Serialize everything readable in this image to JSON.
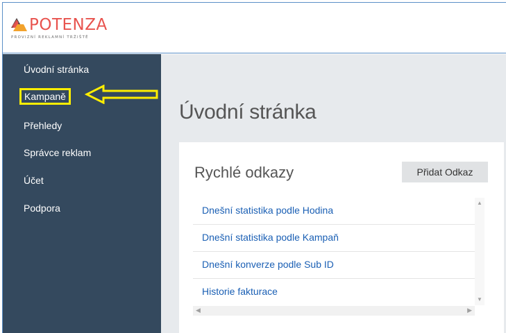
{
  "brand": {
    "name": "POTENZA",
    "tagline": "PROVIZNÍ REKLAMNÍ TRŽIŠTĚ",
    "colors": {
      "red": "#e8534e",
      "orange": "#f2a22c",
      "dark": "#3f3f3f"
    }
  },
  "sidebar": {
    "background": "#34495e",
    "highlight_color": "#ffee00",
    "items": [
      {
        "label": "Úvodní stránka"
      },
      {
        "label": "Kampaně",
        "highlighted": true
      },
      {
        "label": "Přehledy"
      },
      {
        "label": "Správce reklam"
      },
      {
        "label": "Účet"
      },
      {
        "label": "Podpora"
      }
    ]
  },
  "main": {
    "title": "Úvodní stránka",
    "quick_links": {
      "title": "Rychlé odkazy",
      "add_button": "Přidat Odkaz",
      "links": [
        "Dnešní statistika podle Hodina",
        "Dnešní statistika podle Kampaň",
        "Dnešní konverze podle Sub ID",
        "Historie fakturace"
      ]
    }
  }
}
